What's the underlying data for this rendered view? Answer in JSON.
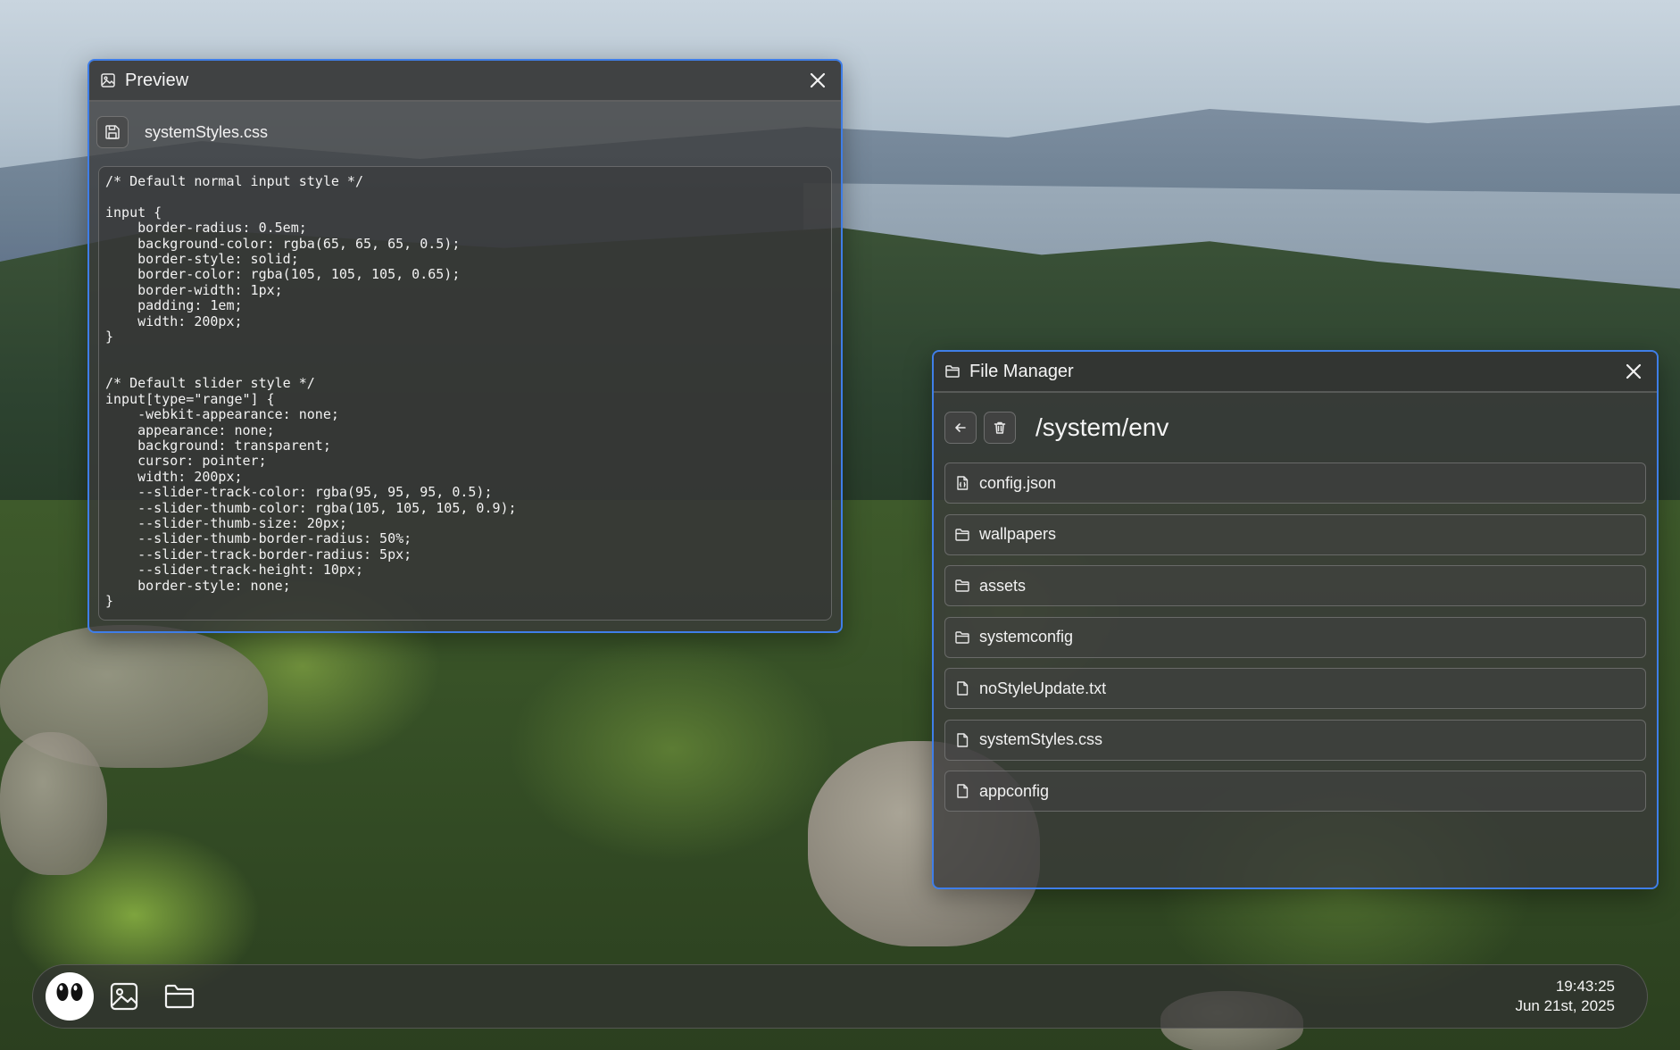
{
  "preview": {
    "title": "Preview",
    "file_name": "systemStyles.css",
    "code": "/* Default normal input style */\n\ninput {\n    border-radius: 0.5em;\n    background-color: rgba(65, 65, 65, 0.5);\n    border-style: solid;\n    border-color: rgba(105, 105, 105, 0.65);\n    border-width: 1px;\n    padding: 1em;\n    width: 200px;\n}\n\n\n/* Default slider style */\ninput[type=\"range\"] {\n    -webkit-appearance: none;\n    appearance: none;\n    background: transparent;\n    cursor: pointer;\n    width: 200px;\n    --slider-track-color: rgba(95, 95, 95, 0.5);\n    --slider-thumb-color: rgba(105, 105, 105, 0.9);\n    --slider-thumb-size: 20px;\n    --slider-thumb-border-radius: 50%;\n    --slider-track-border-radius: 5px;\n    --slider-track-height: 10px;\n    border-style: none;\n}"
  },
  "file_manager": {
    "title": "File Manager",
    "path": "/system/env",
    "items": [
      {
        "name": "config.json",
        "icon": "json-file-icon"
      },
      {
        "name": "wallpapers",
        "icon": "folder-icon"
      },
      {
        "name": "assets",
        "icon": "folder-icon"
      },
      {
        "name": "systemconfig",
        "icon": "folder-icon"
      },
      {
        "name": "noStyleUpdate.txt",
        "icon": "file-icon"
      },
      {
        "name": "systemStyles.css",
        "icon": "file-icon"
      },
      {
        "name": "appconfig",
        "icon": "file-icon"
      }
    ]
  },
  "taskbar": {
    "time": "19:43:25",
    "date": "Jun 21st, 2025",
    "apps": [
      "eyes-logo-icon",
      "image-icon",
      "folder-icon"
    ]
  },
  "colors": {
    "window_border": "#3f7ee8",
    "window_bg": "#3a3a3a"
  }
}
